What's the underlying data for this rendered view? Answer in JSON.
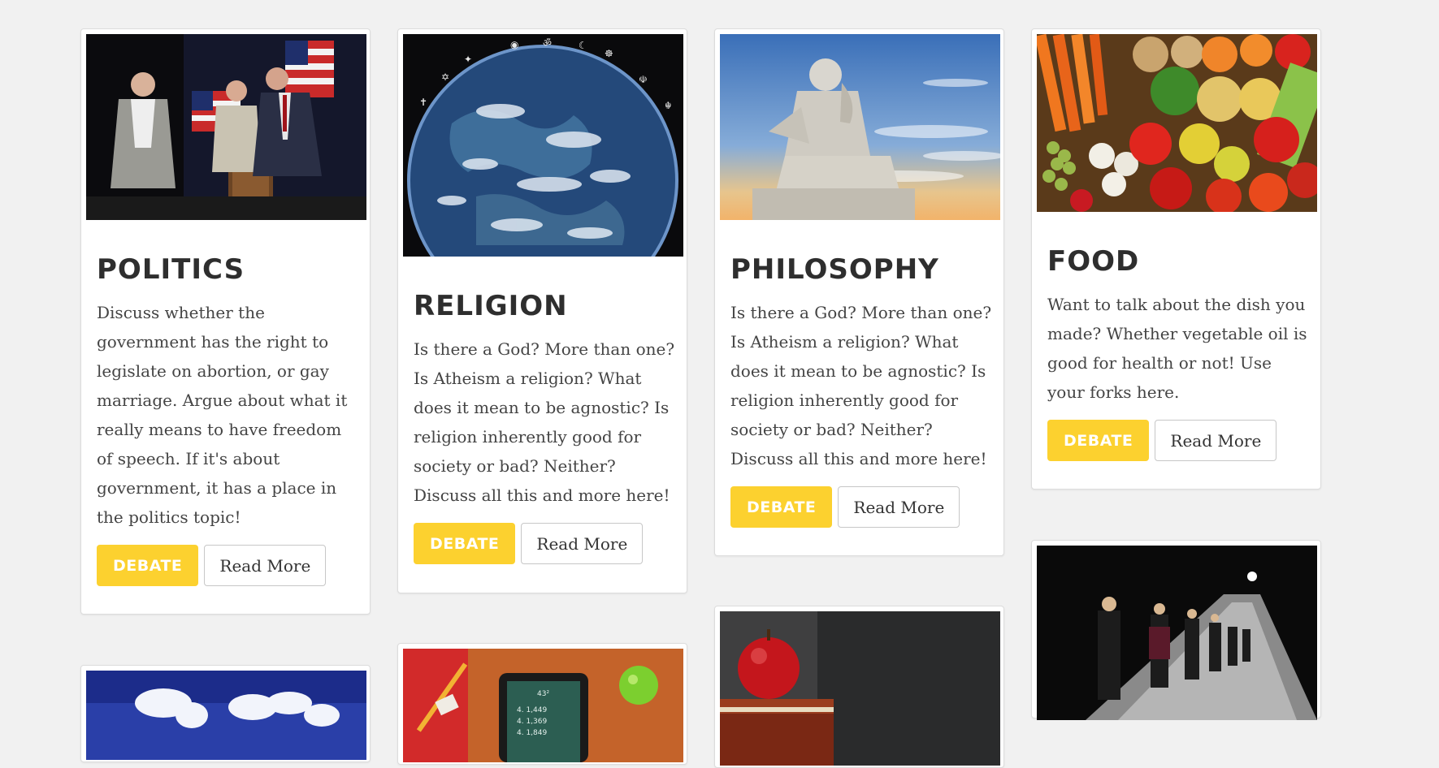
{
  "topics": [
    {
      "title": "POLITICS",
      "description": "Discuss whether the government has the right to legislate on abortion, or gay marriage. Argue about what it really means to have freedom of speech. If it's about government, it has a place in the politics topic!",
      "debate_label": "DEBATE",
      "read_more_label": "Read More",
      "image_subject": "politicians-fighting-photo"
    },
    {
      "title": "RELIGION",
      "description": "Is there a God? More than one? Is Atheism a religion? What does it mean to be agnostic? Is religion inherently good for society or bad? Neither? Discuss all this and more here!",
      "debate_label": "DEBATE",
      "read_more_label": "Read More",
      "image_subject": "earth-with-religious-symbols-photo"
    },
    {
      "title": "PHILOSOPHY",
      "description": "Is there a God? More than one? Is Atheism a religion? What does it mean to be agnostic? Is religion inherently good for society or bad? Neither? Discuss all this and more here!",
      "debate_label": "DEBATE",
      "read_more_label": "Read More",
      "image_subject": "thinker-statue-photo"
    },
    {
      "title": "FOOD",
      "description": "Want to talk about the dish you made? Whether vegetable oil is good for health or not! Use your forks here.",
      "debate_label": "DEBATE",
      "read_more_label": "Read More",
      "image_subject": "vegetables-photo"
    }
  ],
  "partial_cards": [
    {
      "image_subject": "cloud-world-map-photo"
    },
    {
      "image_subject": "tablet-and-apple-on-desk-photo"
    },
    {
      "image_subject": "apple-on-books-chalkboard-photo"
    },
    {
      "image_subject": "fashion-runway-photo"
    }
  ],
  "colors": {
    "background": "#f1f1f1",
    "debate_button": "#fcd12f",
    "title_text": "#2e2e2e",
    "body_text": "#444444"
  }
}
